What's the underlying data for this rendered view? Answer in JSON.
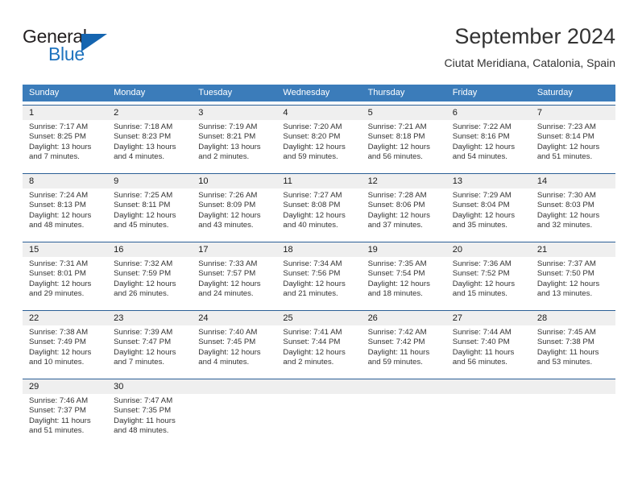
{
  "brand": {
    "name_part1": "General",
    "name_part2": "Blue",
    "logo_icon": "blue-triangle-icon",
    "color_dark": "#231f20",
    "color_blue": "#1e73be"
  },
  "header": {
    "title": "September 2024",
    "subtitle": "Ciutat Meridiana, Catalonia, Spain"
  },
  "theme": {
    "header_row_bg": "#3b7cba",
    "row_divider": "#2c5f96",
    "daynum_bg": "#efefef",
    "text": "#333333"
  },
  "weekdays": [
    "Sunday",
    "Monday",
    "Tuesday",
    "Wednesday",
    "Thursday",
    "Friday",
    "Saturday"
  ],
  "labels": {
    "sunrise_prefix": "Sunrise:",
    "sunset_prefix": "Sunset:",
    "daylight_prefix": "Daylight:"
  },
  "weeks": [
    [
      {
        "day": "1",
        "sunrise": "Sunrise: 7:17 AM",
        "sunset": "Sunset: 8:25 PM",
        "daylight": "Daylight: 13 hours and 7 minutes."
      },
      {
        "day": "2",
        "sunrise": "Sunrise: 7:18 AM",
        "sunset": "Sunset: 8:23 PM",
        "daylight": "Daylight: 13 hours and 4 minutes."
      },
      {
        "day": "3",
        "sunrise": "Sunrise: 7:19 AM",
        "sunset": "Sunset: 8:21 PM",
        "daylight": "Daylight: 13 hours and 2 minutes."
      },
      {
        "day": "4",
        "sunrise": "Sunrise: 7:20 AM",
        "sunset": "Sunset: 8:20 PM",
        "daylight": "Daylight: 12 hours and 59 minutes."
      },
      {
        "day": "5",
        "sunrise": "Sunrise: 7:21 AM",
        "sunset": "Sunset: 8:18 PM",
        "daylight": "Daylight: 12 hours and 56 minutes."
      },
      {
        "day": "6",
        "sunrise": "Sunrise: 7:22 AM",
        "sunset": "Sunset: 8:16 PM",
        "daylight": "Daylight: 12 hours and 54 minutes."
      },
      {
        "day": "7",
        "sunrise": "Sunrise: 7:23 AM",
        "sunset": "Sunset: 8:14 PM",
        "daylight": "Daylight: 12 hours and 51 minutes."
      }
    ],
    [
      {
        "day": "8",
        "sunrise": "Sunrise: 7:24 AM",
        "sunset": "Sunset: 8:13 PM",
        "daylight": "Daylight: 12 hours and 48 minutes."
      },
      {
        "day": "9",
        "sunrise": "Sunrise: 7:25 AM",
        "sunset": "Sunset: 8:11 PM",
        "daylight": "Daylight: 12 hours and 45 minutes."
      },
      {
        "day": "10",
        "sunrise": "Sunrise: 7:26 AM",
        "sunset": "Sunset: 8:09 PM",
        "daylight": "Daylight: 12 hours and 43 minutes."
      },
      {
        "day": "11",
        "sunrise": "Sunrise: 7:27 AM",
        "sunset": "Sunset: 8:08 PM",
        "daylight": "Daylight: 12 hours and 40 minutes."
      },
      {
        "day": "12",
        "sunrise": "Sunrise: 7:28 AM",
        "sunset": "Sunset: 8:06 PM",
        "daylight": "Daylight: 12 hours and 37 minutes."
      },
      {
        "day": "13",
        "sunrise": "Sunrise: 7:29 AM",
        "sunset": "Sunset: 8:04 PM",
        "daylight": "Daylight: 12 hours and 35 minutes."
      },
      {
        "day": "14",
        "sunrise": "Sunrise: 7:30 AM",
        "sunset": "Sunset: 8:03 PM",
        "daylight": "Daylight: 12 hours and 32 minutes."
      }
    ],
    [
      {
        "day": "15",
        "sunrise": "Sunrise: 7:31 AM",
        "sunset": "Sunset: 8:01 PM",
        "daylight": "Daylight: 12 hours and 29 minutes."
      },
      {
        "day": "16",
        "sunrise": "Sunrise: 7:32 AM",
        "sunset": "Sunset: 7:59 PM",
        "daylight": "Daylight: 12 hours and 26 minutes."
      },
      {
        "day": "17",
        "sunrise": "Sunrise: 7:33 AM",
        "sunset": "Sunset: 7:57 PM",
        "daylight": "Daylight: 12 hours and 24 minutes."
      },
      {
        "day": "18",
        "sunrise": "Sunrise: 7:34 AM",
        "sunset": "Sunset: 7:56 PM",
        "daylight": "Daylight: 12 hours and 21 minutes."
      },
      {
        "day": "19",
        "sunrise": "Sunrise: 7:35 AM",
        "sunset": "Sunset: 7:54 PM",
        "daylight": "Daylight: 12 hours and 18 minutes."
      },
      {
        "day": "20",
        "sunrise": "Sunrise: 7:36 AM",
        "sunset": "Sunset: 7:52 PM",
        "daylight": "Daylight: 12 hours and 15 minutes."
      },
      {
        "day": "21",
        "sunrise": "Sunrise: 7:37 AM",
        "sunset": "Sunset: 7:50 PM",
        "daylight": "Daylight: 12 hours and 13 minutes."
      }
    ],
    [
      {
        "day": "22",
        "sunrise": "Sunrise: 7:38 AM",
        "sunset": "Sunset: 7:49 PM",
        "daylight": "Daylight: 12 hours and 10 minutes."
      },
      {
        "day": "23",
        "sunrise": "Sunrise: 7:39 AM",
        "sunset": "Sunset: 7:47 PM",
        "daylight": "Daylight: 12 hours and 7 minutes."
      },
      {
        "day": "24",
        "sunrise": "Sunrise: 7:40 AM",
        "sunset": "Sunset: 7:45 PM",
        "daylight": "Daylight: 12 hours and 4 minutes."
      },
      {
        "day": "25",
        "sunrise": "Sunrise: 7:41 AM",
        "sunset": "Sunset: 7:44 PM",
        "daylight": "Daylight: 12 hours and 2 minutes."
      },
      {
        "day": "26",
        "sunrise": "Sunrise: 7:42 AM",
        "sunset": "Sunset: 7:42 PM",
        "daylight": "Daylight: 11 hours and 59 minutes."
      },
      {
        "day": "27",
        "sunrise": "Sunrise: 7:44 AM",
        "sunset": "Sunset: 7:40 PM",
        "daylight": "Daylight: 11 hours and 56 minutes."
      },
      {
        "day": "28",
        "sunrise": "Sunrise: 7:45 AM",
        "sunset": "Sunset: 7:38 PM",
        "daylight": "Daylight: 11 hours and 53 minutes."
      }
    ],
    [
      {
        "day": "29",
        "sunrise": "Sunrise: 7:46 AM",
        "sunset": "Sunset: 7:37 PM",
        "daylight": "Daylight: 11 hours and 51 minutes."
      },
      {
        "day": "30",
        "sunrise": "Sunrise: 7:47 AM",
        "sunset": "Sunset: 7:35 PM",
        "daylight": "Daylight: 11 hours and 48 minutes."
      },
      {
        "day": "",
        "sunrise": "",
        "sunset": "",
        "daylight": ""
      },
      {
        "day": "",
        "sunrise": "",
        "sunset": "",
        "daylight": ""
      },
      {
        "day": "",
        "sunrise": "",
        "sunset": "",
        "daylight": ""
      },
      {
        "day": "",
        "sunrise": "",
        "sunset": "",
        "daylight": ""
      },
      {
        "day": "",
        "sunrise": "",
        "sunset": "",
        "daylight": ""
      }
    ]
  ]
}
